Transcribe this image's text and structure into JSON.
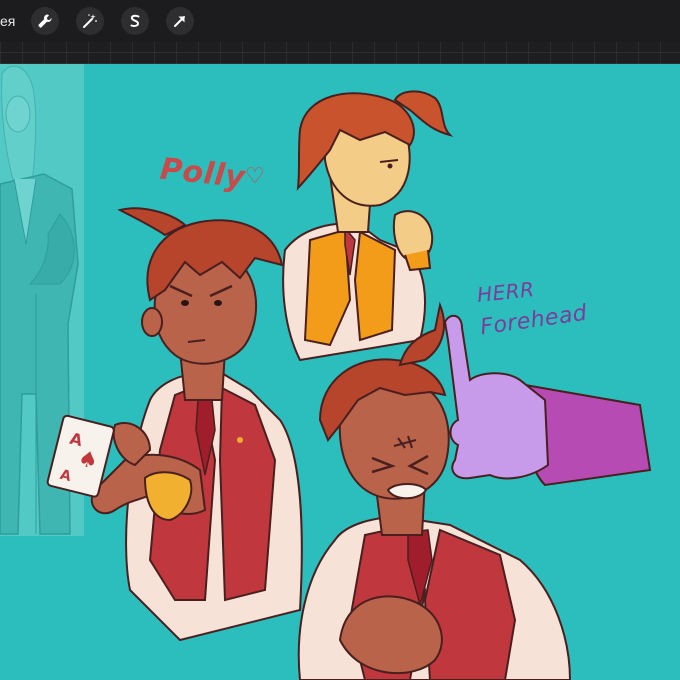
{
  "toolbar": {
    "gallery_label": "ея",
    "tools": [
      {
        "icon": "wrench-icon",
        "name": "actions"
      },
      {
        "icon": "magic-wand-icon",
        "name": "adjustments"
      },
      {
        "icon": "selection-s-icon",
        "name": "selection"
      },
      {
        "icon": "arrow-cursor-icon",
        "name": "transform"
      }
    ]
  },
  "canvas": {
    "background_color": "#2bbebc",
    "annotations": {
      "polly": "Polly",
      "heart": "♡",
      "herr": "HERR",
      "forehead": "Forehead"
    },
    "card": {
      "rank": "A",
      "suit": "♠"
    }
  },
  "colors": {
    "skin": "#b9634a",
    "hair": "#b7452c",
    "vest_red": "#c0383e",
    "vest_orange": "#f39c1a",
    "shirt": "#f7e2d8",
    "glove": "#c79aea",
    "sleeve": "#b64bb3",
    "outline": "#4a1f1f"
  }
}
